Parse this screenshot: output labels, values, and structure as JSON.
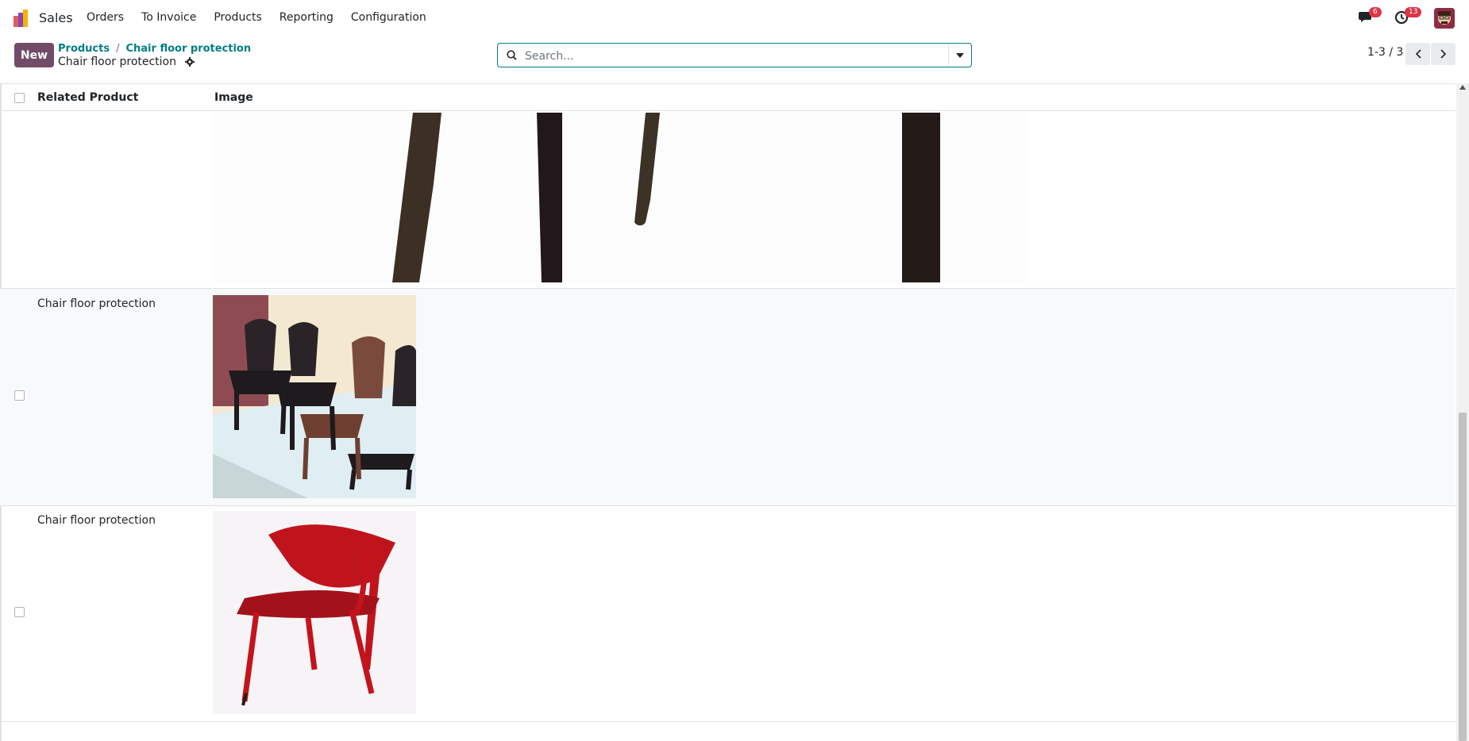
{
  "navbar": {
    "app_name": "Sales",
    "menu": [
      "Orders",
      "To Invoice",
      "Products",
      "Reporting",
      "Configuration"
    ],
    "messages_count": "6",
    "activities_count": "13"
  },
  "control_panel": {
    "new_label": "New",
    "breadcrumb": [
      "Products",
      "Chair floor protection"
    ],
    "current": "Chair floor protection",
    "search_placeholder": "Search...",
    "pager": "1-3 / 3"
  },
  "list": {
    "columns": [
      "Related Product",
      "Image"
    ],
    "rows": [
      {
        "product": "",
        "image": "chair-legs-photo"
      },
      {
        "product": "Chair floor protection",
        "image": "stacked-plastic-chairs-photo"
      },
      {
        "product": "Chair floor protection",
        "image": "red-chair-photo"
      }
    ]
  },
  "colors": {
    "brand": "#714b67",
    "link": "#017e84",
    "badge": "#dc3545"
  }
}
